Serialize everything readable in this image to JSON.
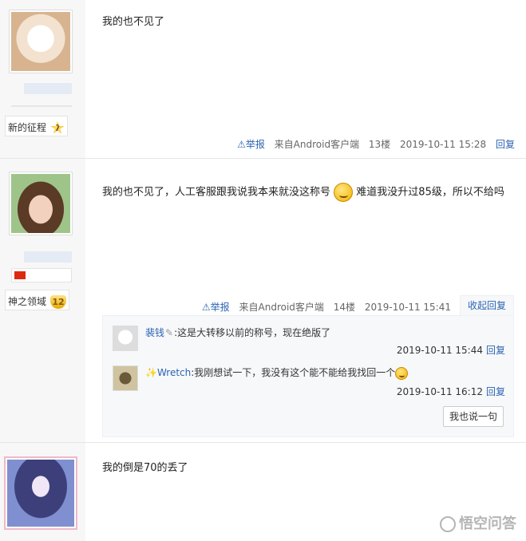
{
  "posts": [
    {
      "text": "我的也不见了",
      "badge": "新的征程",
      "level": "7",
      "report": "举报",
      "source": "来自Android客户端",
      "floor": "13楼",
      "time": "2019-10-11 15:28",
      "reply": "回复"
    },
    {
      "text": "我的也不见了，人工客服跟我说我本来就没这称号",
      "text_after": "难道我没升过85级，所以不给吗",
      "badge": "神之领域",
      "level": "12",
      "report": "举报",
      "source": "来自Android客户端",
      "floor": "14楼",
      "time": "2019-10-11 15:41",
      "collapse": "收起回复",
      "replies": [
        {
          "user": "裴钱",
          "text": ":这是大转移以前的称号，现在绝版了",
          "time": "2019-10-11 15:44",
          "reply": "回复"
        },
        {
          "user": "Wretch",
          "text": ":我刚想试一下，我没有这个能不能给我找回一个",
          "time": "2019-10-11 16:12",
          "reply": "回复"
        }
      ],
      "say_button": "我也说一句"
    },
    {
      "text": "我的倒是70的丢了"
    }
  ],
  "watermark": "悟空问答",
  "colors": {
    "link": "#2d64b3",
    "sidebar": "#f7f7f7"
  }
}
